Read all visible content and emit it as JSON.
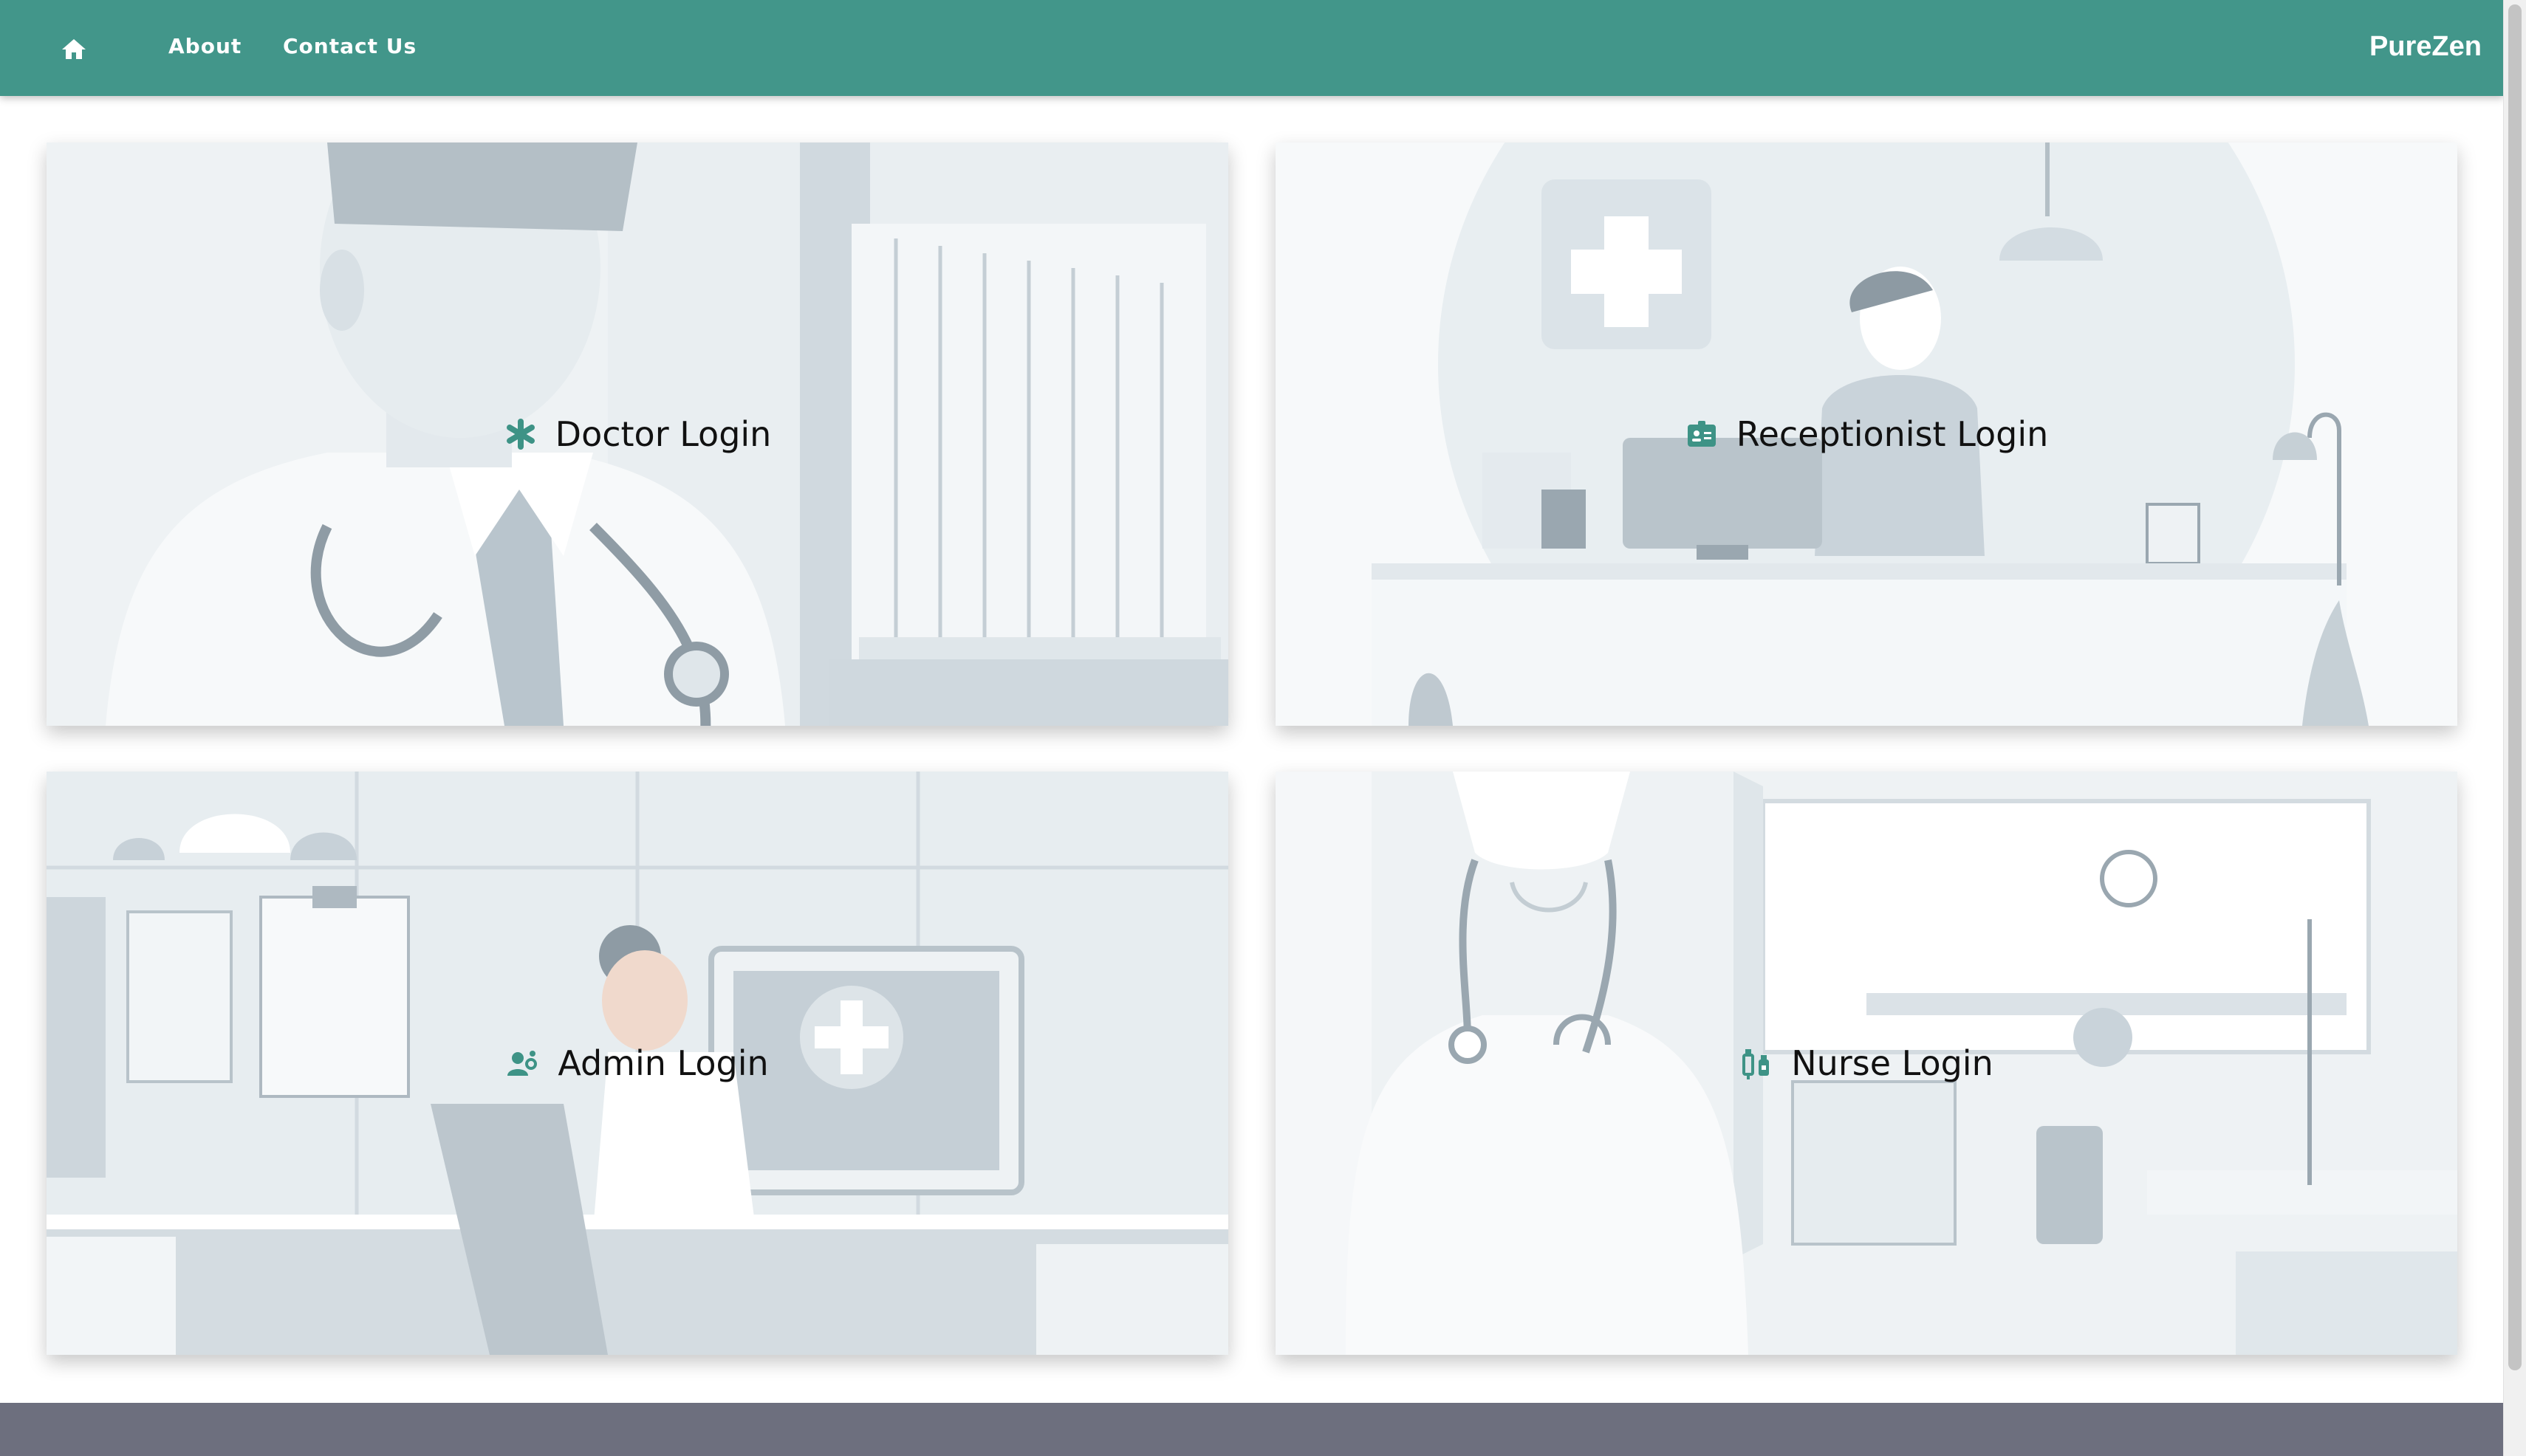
{
  "navbar": {
    "home_icon": "home-icon",
    "links": [
      {
        "label": "About"
      },
      {
        "label": "Contact Us"
      }
    ],
    "brand": "PureZen"
  },
  "cards": [
    {
      "label": "Doctor Login",
      "icon": "asterisk-medical-icon"
    },
    {
      "label": "Receptionist Login",
      "icon": "id-badge-icon"
    },
    {
      "label": "Admin Login",
      "icon": "user-gear-icon"
    },
    {
      "label": "Nurse Login",
      "icon": "syringe-vial-icon"
    }
  ],
  "colors": {
    "primary": "#42968a",
    "footer": "#6d6f7e",
    "card_label": "#111111"
  }
}
